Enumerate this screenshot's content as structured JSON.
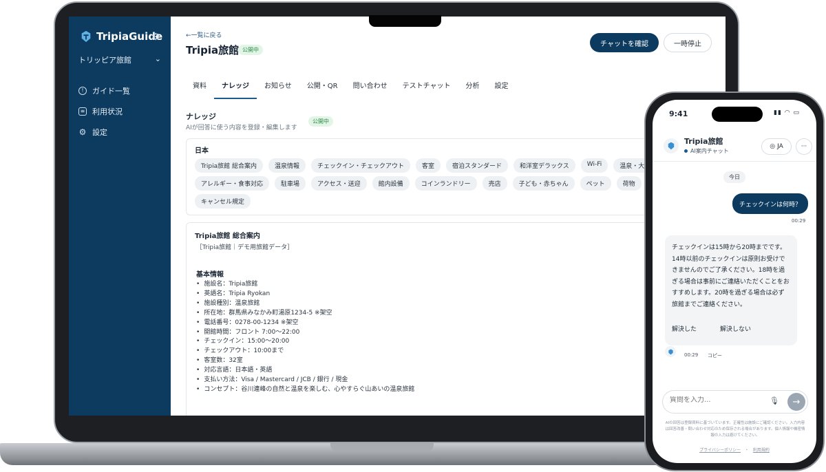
{
  "app": {
    "name": "TripiaGuide",
    "org": "トリッピア旅館"
  },
  "sidebar": {
    "items": [
      {
        "label": "ガイド一覧",
        "icon": "info-icon"
      },
      {
        "label": "利用状況",
        "icon": "chart-icon"
      },
      {
        "label": "設定",
        "icon": "gear-icon"
      }
    ]
  },
  "header": {
    "back": "←一覧に戻る",
    "title": "Tripia旅館",
    "status": "公開中",
    "primary_button": "チャットを確認",
    "secondary_button": "一時停止"
  },
  "tabs": [
    "資料",
    "ナレッジ",
    "お知らせ",
    "公開・QR",
    "問い合わせ",
    "テストチャット",
    "分析",
    "設定"
  ],
  "active_tab": "ナレッジ",
  "knowledge": {
    "title": "ナレッジ",
    "subtitle": "AIが回答に使う内容を登録・編集します",
    "status": "公開中",
    "language": "日本",
    "tags_row1": [
      "Tripia旅館 総合案内",
      "温泉情報",
      "チェックイン・チェックアウト",
      "客室",
      "宿泊スタンダード",
      "和洋室デラックス",
      "Wi-Fi",
      "温泉・大浴"
    ],
    "tags_row2": [
      "アレルギー・食事対応",
      "駐車場",
      "アクセス・送迎",
      "館内設備",
      "コインランドリー",
      "売店",
      "子ども・赤ちゃん",
      "ペット",
      "荷物"
    ],
    "tags_row3": [
      "キャンセル規定"
    ]
  },
  "document": {
    "title": "Tripia旅館 総合案内",
    "subtitle": "［Tripia旅館｜デモ用旅館データ］",
    "heading": "基本情報",
    "items": [
      "施設名：Tripia旅館",
      "英語名：Tripia Ryokan",
      "施設種別：温泉旅館",
      "所在地：群馬県みなかみ町湯原1234-5 ※架空",
      "電話番号：0278-00-1234 ※架空",
      "開館時間：フロント 7:00〜22:00",
      "チェックイン：15:00〜20:00",
      "チェックアウト：10:00まで",
      "客室数：32室",
      "対応言語：日本語・英語",
      "支払い方法：Visa / Mastercard / JCB / 銀行 / 現金",
      "コンセプト：谷川連峰の自然と温泉を楽しむ、心やすらぐ山あいの温泉旅館"
    ]
  },
  "phone": {
    "time": "9:41",
    "chat_name": "Tripia旅館",
    "chat_status": "AI案内チャット",
    "lang": "JA",
    "more": "···",
    "day": "今日",
    "user_message": "チェックインは何時？",
    "user_time": "00:29",
    "bot_message": "チェックインは15時から20時までです。14時以前のチェックインは原則お受けできませんのでご了承ください。18時を過ぎる場合は事前にご連絡いただくことをおすすめします。20時を過ぎる場合は必ず旅館までご連絡ください。",
    "resolved": "解決した",
    "not_resolved": "解決しない",
    "bot_time": "00:29",
    "copy": "コピー",
    "input_placeholder": "質問を入力...",
    "disclaimer": "AIの回答は登録資料に基づいています。正確性は施設にご確認ください。入力内容は回答改善・問い合わせ対応のため保存される場合があります。個人情報や機密情報の入力は避けてください。",
    "privacy": "プライバシーポリシー",
    "separator": "・",
    "terms": "利用規約"
  },
  "colors": {
    "brand": "#0c3b5f",
    "accent": "#1a5a8f",
    "badge_bg": "#e3f5e7",
    "badge_text": "#2e8b4a"
  }
}
